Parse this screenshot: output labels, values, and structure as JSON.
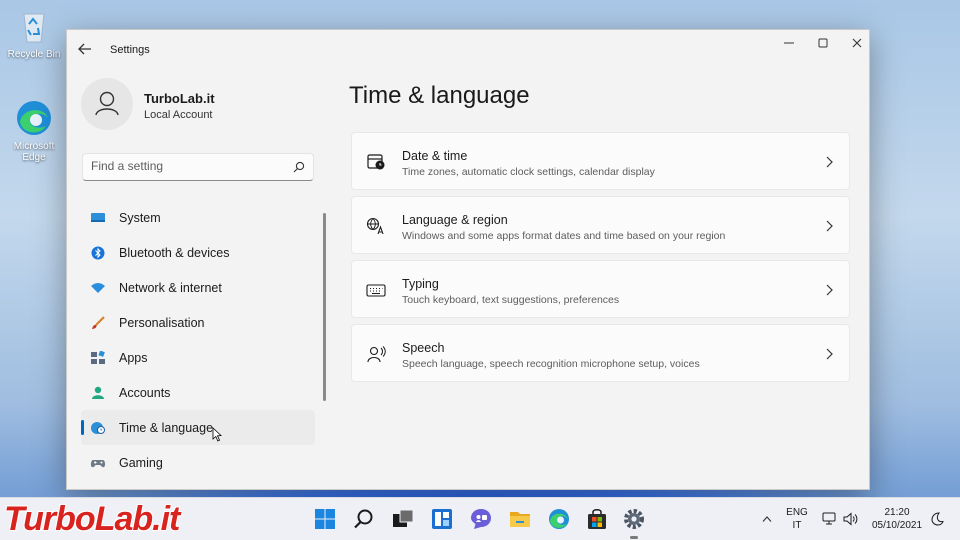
{
  "desktop": {
    "icons": [
      {
        "label": "Recycle Bin",
        "icon": "recycle-bin-icon"
      },
      {
        "label": "Microsoft Edge",
        "icon": "edge-icon"
      }
    ]
  },
  "window": {
    "title": "Settings",
    "back_icon": "back-arrow-icon",
    "controls": [
      "minimize-icon",
      "maximize-icon",
      "close-icon"
    ]
  },
  "profile": {
    "name": "TurboLab.it",
    "account_type": "Local Account"
  },
  "search": {
    "placeholder": "Find a setting",
    "value": ""
  },
  "sidebar": {
    "items": [
      {
        "label": "System",
        "icon": "system-icon",
        "active": false
      },
      {
        "label": "Bluetooth & devices",
        "icon": "bluetooth-icon",
        "active": false
      },
      {
        "label": "Network & internet",
        "icon": "wifi-icon",
        "active": false
      },
      {
        "label": "Personalisation",
        "icon": "brush-icon",
        "active": false
      },
      {
        "label": "Apps",
        "icon": "apps-icon",
        "active": false
      },
      {
        "label": "Accounts",
        "icon": "accounts-icon",
        "active": false
      },
      {
        "label": "Time & language",
        "icon": "globe-clock-icon",
        "active": true
      },
      {
        "label": "Gaming",
        "icon": "gamepad-icon",
        "active": false
      }
    ]
  },
  "main": {
    "title": "Time & language",
    "cards": [
      {
        "title": "Date & time",
        "subtitle": "Time zones, automatic clock settings, calendar display",
        "icon": "calendar-clock-icon"
      },
      {
        "title": "Language & region",
        "subtitle": "Windows and some apps format dates and time based on your region",
        "icon": "language-icon"
      },
      {
        "title": "Typing",
        "subtitle": "Touch keyboard, text suggestions, preferences",
        "icon": "keyboard-icon"
      },
      {
        "title": "Speech",
        "subtitle": "Speech language, speech recognition microphone setup, voices",
        "icon": "speech-icon"
      }
    ]
  },
  "taskbar": {
    "brand": "TurboLab.it",
    "apps": [
      "start-icon",
      "search-icon",
      "task-view-icon",
      "widgets-icon",
      "chat-icon",
      "file-explorer-icon",
      "edge-icon",
      "store-icon",
      "settings-icon"
    ],
    "tray": {
      "lang_top": "ENG",
      "lang_bottom": "IT",
      "time": "21:20",
      "date": "05/10/2021"
    }
  },
  "colors": {
    "accent": "#0067c0",
    "brand_red": "#d8231f"
  }
}
